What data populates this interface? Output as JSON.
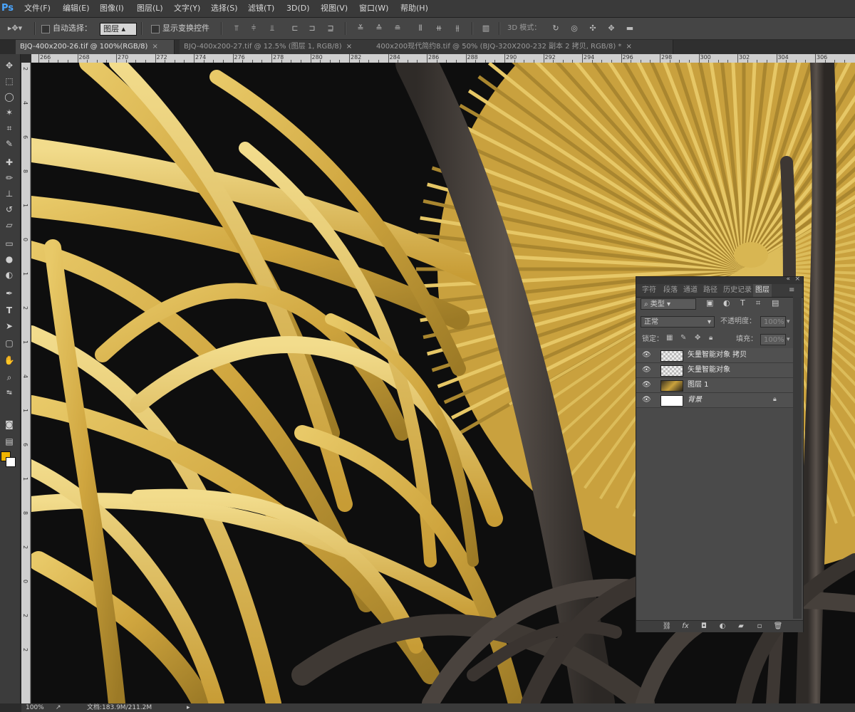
{
  "app": {
    "logo": "Ps"
  },
  "menu": [
    "文件(F)",
    "编辑(E)",
    "图像(I)",
    "图层(L)",
    "文字(Y)",
    "选择(S)",
    "滤镜(T)",
    "3D(D)",
    "视图(V)",
    "窗口(W)",
    "帮助(H)"
  ],
  "options": {
    "auto_select_label": "自动选择：",
    "auto_select_value": "图层",
    "show_transform_label": "显示变换控件",
    "mode_3d_label": "3D 模式："
  },
  "tabs": [
    {
      "label": "BJQ-400x200-26.tif @ 100%(RGB/8)"
    },
    {
      "label": "BJQ-400x200-27.tif @ 12.5% (图层 1, RGB/8)"
    },
    {
      "label": "400x200现代简约8.tif @ 50% (BJQ-320X200-232 副本 2 拷贝, RGB/8) *"
    }
  ],
  "ruler_top": [
    "266",
    "268",
    "270",
    "272",
    "274",
    "276",
    "278",
    "280",
    "282",
    "284",
    "286",
    "288",
    "290",
    "292",
    "294",
    "296",
    "298",
    "300",
    "302",
    "304",
    "306"
  ],
  "ruler_left": [
    "2",
    "4",
    "6",
    "8",
    "1",
    "0",
    "1",
    "2",
    "1",
    "4",
    "1",
    "6",
    "1",
    "8",
    "2",
    "0",
    "2",
    "2"
  ],
  "status": {
    "zoom": "100%",
    "doc": "文档:183.9M/211.2M"
  },
  "layers_panel": {
    "tabs": [
      "字符",
      "段落",
      "通道",
      "路径",
      "历史记录",
      "图层"
    ],
    "filter_kind": "类型",
    "blend_mode": "正常",
    "opacity_label": "不透明度：",
    "opacity_value": "100%",
    "lock_label": "锁定：",
    "fill_label": "填充：",
    "fill_value": "100%",
    "layers": [
      {
        "name": "矢量智能对象 拷贝"
      },
      {
        "name": "矢量智能对象"
      },
      {
        "name": "图层 1"
      },
      {
        "name": "背景"
      }
    ]
  },
  "colors": {
    "foreground": "#f0b400",
    "background": "#ffffff",
    "leaf_gold": "#d4ad45",
    "leaf_dark": "#4a4440"
  }
}
